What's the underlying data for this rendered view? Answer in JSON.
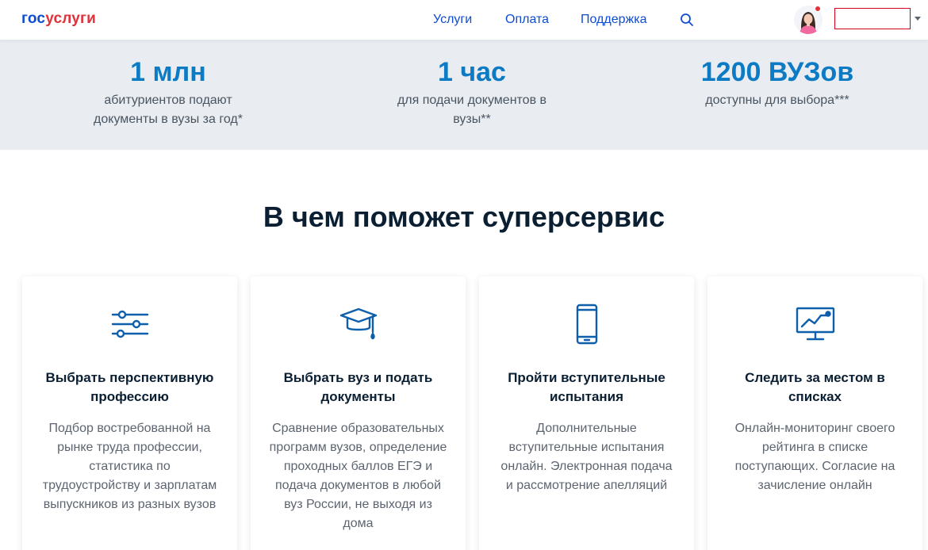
{
  "header": {
    "logo_part1": "гос",
    "logo_part2": "услуги",
    "nav": [
      "Услуги",
      "Оплата",
      "Поддержка"
    ]
  },
  "stats": [
    {
      "value": "1 млн",
      "description": "абитуриентов подают документы в вузы за год*"
    },
    {
      "value": "1 час",
      "description": "для подачи документов в вузы**"
    },
    {
      "value": "1200 ВУЗов",
      "description": "доступны для выбора***"
    }
  ],
  "section": {
    "title": "В чем поможет суперсервис"
  },
  "cards": [
    {
      "icon": "sliders-icon",
      "title": "Выбрать перспективную профессию",
      "text": "Подбор востребованной на рынке труда профессии, статистика по трудоустройству и зарплатам выпускников из разных вузов"
    },
    {
      "icon": "graduation-cap-icon",
      "title": "Выбрать вуз и подать документы",
      "text": "Сравнение образовательных программ вузов, определение проходных баллов ЕГЭ и подача документов в любой вуз России, не выходя из дома"
    },
    {
      "icon": "smartphone-icon",
      "title": "Пройти вступительные испытания",
      "text": "Дополнительные вступительные испытания онлайн. Электронная подача и рассмотрение апелляций"
    },
    {
      "icon": "monitor-chart-icon",
      "title": "Следить за местом в списках",
      "text": "Онлайн-мониторинг своего рейтинга в списке поступающих. Согласие на зачисление онлайн"
    }
  ],
  "colors": {
    "brand_blue": "#0d4cd3",
    "brand_red": "#e1313a",
    "stat_blue": "#0d7ac4",
    "icon_blue": "#0d5fab",
    "stats_bg": "#e9ecf0"
  }
}
